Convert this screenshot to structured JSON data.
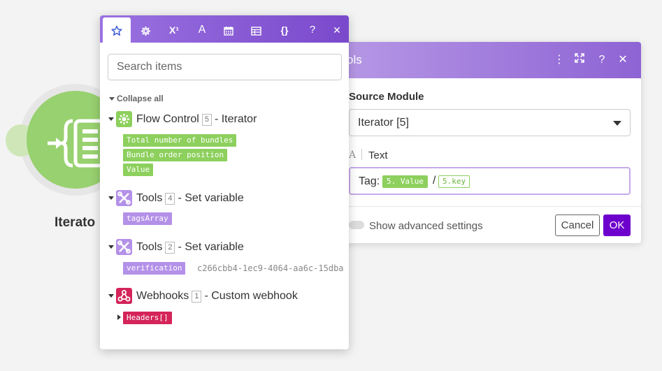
{
  "canvas": {
    "module_label": "Iterato"
  },
  "dialog": {
    "title": "ols",
    "header_buttons": [
      "more-icon",
      "expand-icon",
      "help-icon",
      "close-icon"
    ],
    "source_module_label": "Source Module",
    "source_module_value": "Iterator [5]",
    "text_type_icon": "A",
    "text_type_label": "Text",
    "text_prefix": "Tag:",
    "pill_value": "5. Value",
    "slash": "/",
    "pill_key": "5.key",
    "advanced_label": "Show advanced settings",
    "cancel_label": "Cancel",
    "ok_label": "OK"
  },
  "panel": {
    "tabs": [
      "star-icon",
      "gear-icon",
      "superscript-icon",
      "text-format-icon",
      "calendar-icon",
      "table-icon",
      "braces-icon",
      "help-icon",
      "close-icon"
    ],
    "tab_labels": {
      "superscript": "X¹",
      "text": "A",
      "braces": "{}",
      "help": "?",
      "close": "✕"
    },
    "search_placeholder": "Search items",
    "collapse_all": "Collapse all",
    "modules": [
      {
        "name": "Flow Control",
        "number": "5",
        "suffix": "- Iterator",
        "color": "#8dd05d",
        "items": [
          "Total number of bundles",
          "Bundle order position",
          "Value"
        ]
      },
      {
        "name": "Tools",
        "number": "4",
        "suffix": "- Set variable",
        "color": "#b491e8",
        "items": [
          "tagsArray"
        ]
      },
      {
        "name": "Tools",
        "number": "2",
        "suffix": "- Set variable",
        "color": "#b491e8",
        "items": [
          "verification"
        ],
        "item_value": "c266cbb4-1ec9-4064-aa6c-15dba"
      },
      {
        "name": "Webhooks",
        "number": "1",
        "suffix": "- Custom webhook",
        "color": "#d4245a",
        "items": [
          "Headers[]"
        ]
      }
    ]
  },
  "colors": {
    "accent_purple": "#7a49cc",
    "ok_button": "#6d00cc",
    "flow_green": "#8dd05d",
    "tools_purple": "#b491e8",
    "webhooks_red": "#d4245a"
  }
}
